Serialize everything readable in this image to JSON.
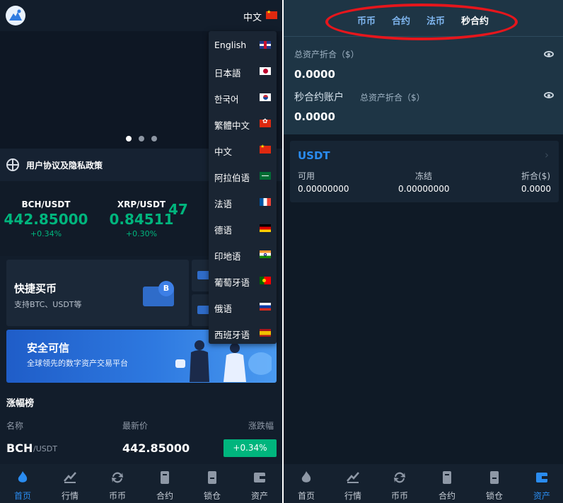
{
  "left": {
    "header": {
      "current_language": "中文"
    },
    "carousel": {
      "dot_count": 3,
      "active_index": 0
    },
    "notice": {
      "text": "用户协议及隐私政策"
    },
    "tickers": [
      {
        "pair": "BCH/USDT",
        "price": "442.85000",
        "change": "+0.34%"
      },
      {
        "pair": "XRP/USDT",
        "price": "0.84511",
        "change": "+0.30%"
      },
      {
        "pair": "",
        "price": "47",
        "change": ""
      }
    ],
    "quick_buy": {
      "title": "快捷买币",
      "subtitle": "支持BTC、USDT等",
      "coin_letter": "B"
    },
    "safe": {
      "title": "安全可信",
      "subtitle": "全球领先的数字资产交易平台"
    },
    "ranking": {
      "title": "涨幅榜",
      "headers": {
        "name": "名称",
        "price": "最新价",
        "change": "涨跌幅"
      },
      "rows": [
        {
          "symbol": "BCH",
          "quote": "/USDT",
          "price": "442.85000",
          "change": "+0.34%"
        }
      ]
    },
    "language_menu": [
      {
        "label": "English",
        "flag": "uk-flag-icon"
      },
      {
        "label": "日本語",
        "flag": "japan-flag-icon"
      },
      {
        "label": "한국어",
        "flag": "korea-flag-icon"
      },
      {
        "label": "繁體中文",
        "flag": "hongkong-flag-icon"
      },
      {
        "label": "中文",
        "flag": "china-flag-icon"
      },
      {
        "label": "阿拉伯语",
        "flag": "saudi-flag-icon"
      },
      {
        "label": "法语",
        "flag": "france-flag-icon"
      },
      {
        "label": "德语",
        "flag": "germany-flag-icon"
      },
      {
        "label": "印地语",
        "flag": "india-flag-icon"
      },
      {
        "label": "葡萄牙语",
        "flag": "portugal-flag-icon"
      },
      {
        "label": "俄语",
        "flag": "russia-flag-icon"
      },
      {
        "label": "西班牙语",
        "flag": "spain-flag-icon"
      }
    ],
    "nav": [
      {
        "label": "首页",
        "icon": "home-flame-icon",
        "active": true
      },
      {
        "label": "行情",
        "icon": "market-icon",
        "active": false
      },
      {
        "label": "币币",
        "icon": "exchange-icon",
        "active": false
      },
      {
        "label": "合约",
        "icon": "contract-icon",
        "active": false
      },
      {
        "label": "锁仓",
        "icon": "lock-icon",
        "active": false
      },
      {
        "label": "资产",
        "icon": "wallet-icon",
        "active": false
      }
    ]
  },
  "right": {
    "tabs": [
      "币币",
      "合约",
      "法币",
      "秒合约"
    ],
    "active_tab": "秒合约",
    "total_assets": {
      "label": "总资产折合（$）",
      "value": "0.0000"
    },
    "second_contract": {
      "title": "秒合约账户",
      "subtitle": "总资产折合（$）",
      "value": "0.0000"
    },
    "usdt_card": {
      "title": "USDT",
      "headers": {
        "available": "可用",
        "frozen": "冻结",
        "converted": "折合($)"
      },
      "values": {
        "available": "0.00000000",
        "frozen": "0.00000000",
        "converted": "0.0000"
      }
    },
    "nav": [
      {
        "label": "首页",
        "icon": "home-flame-icon",
        "active": false
      },
      {
        "label": "行情",
        "icon": "market-icon",
        "active": false
      },
      {
        "label": "币币",
        "icon": "exchange-icon",
        "active": false
      },
      {
        "label": "合约",
        "icon": "contract-icon",
        "active": false
      },
      {
        "label": "锁仓",
        "icon": "lock-icon",
        "active": false
      },
      {
        "label": "资产",
        "icon": "wallet-icon",
        "active": true
      }
    ]
  },
  "colors": {
    "accent_blue": "#2a8cf0",
    "up_green": "#00b57d",
    "highlight_red": "#e6161c"
  }
}
